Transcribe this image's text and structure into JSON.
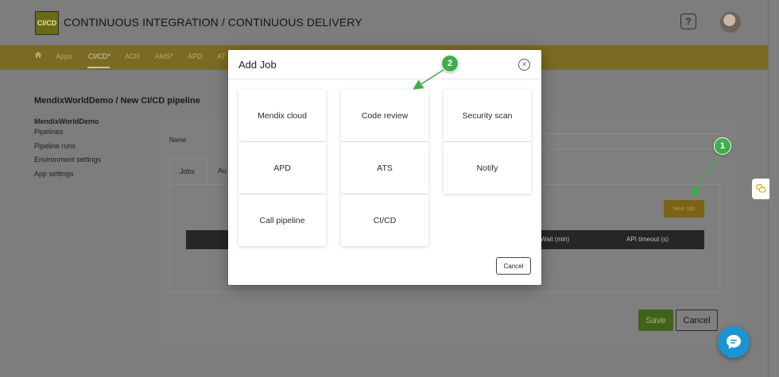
{
  "header": {
    "logo_text": "CI/CD",
    "title": "CONTINUOUS INTEGRATION / CONTINUOUS DELIVERY",
    "help_label": "?"
  },
  "nav": {
    "items": [
      {
        "label": "Apps"
      },
      {
        "label": "CI/CD*"
      },
      {
        "label": "ACR"
      },
      {
        "label": "AMS*"
      },
      {
        "label": "APD"
      },
      {
        "label": "AT"
      }
    ]
  },
  "page": {
    "heading": "MendixWorldDemo / New CI/CD pipeline",
    "sidebar": [
      {
        "label": "MendixWorldDemo"
      },
      {
        "label": "Pipelines"
      },
      {
        "label": "Pipeline runs"
      },
      {
        "label": "Environment settings"
      },
      {
        "label": "App settings"
      }
    ],
    "name_label": "Name",
    "tabs": [
      {
        "label": "Jobs"
      },
      {
        "label": "Au"
      }
    ],
    "new_job_label": "New Job",
    "table_headers": [
      "Wait (min)",
      "API timeout (s)"
    ],
    "save_label": "Save",
    "cancel_label": "Cancel"
  },
  "modal": {
    "title": "Add Job",
    "close_label": "×",
    "tiles": [
      {
        "label": "Mendix cloud"
      },
      {
        "label": "Code review"
      },
      {
        "label": "Security scan"
      },
      {
        "label": "APD"
      },
      {
        "label": "ATS"
      },
      {
        "label": "Notify"
      },
      {
        "label": "Call pipeline"
      },
      {
        "label": "CI/CD"
      }
    ],
    "cancel_label": "Cancel"
  },
  "annotations": {
    "step1": "1",
    "step2": "2",
    "color": "#3fae4c"
  },
  "colors": {
    "brand_gold": "#d9a300",
    "save_green": "#6fb82f",
    "chat_blue": "#1a94d3"
  }
}
